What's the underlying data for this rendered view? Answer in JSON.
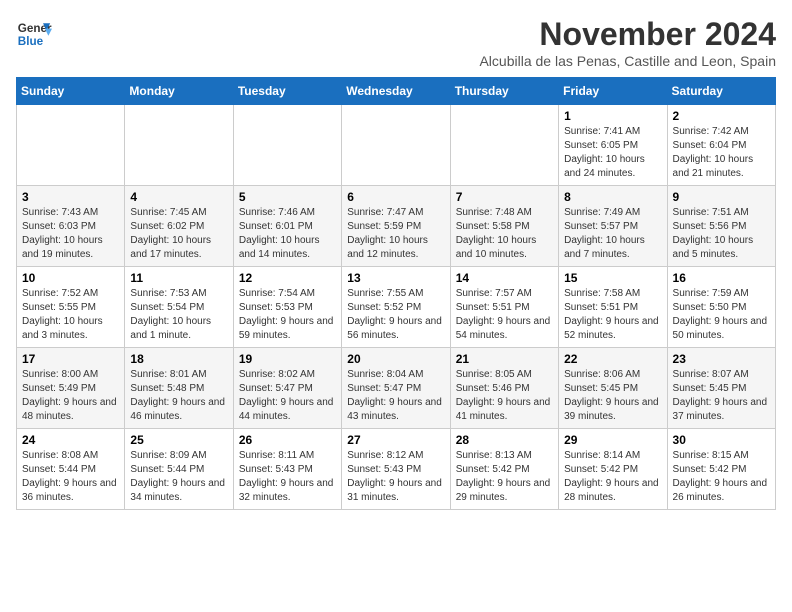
{
  "logo": {
    "line1": "General",
    "line2": "Blue"
  },
  "title": "November 2024",
  "subtitle": "Alcubilla de las Penas, Castille and Leon, Spain",
  "weekdays": [
    "Sunday",
    "Monday",
    "Tuesday",
    "Wednesday",
    "Thursday",
    "Friday",
    "Saturday"
  ],
  "weeks": [
    [
      {
        "day": "",
        "info": ""
      },
      {
        "day": "",
        "info": ""
      },
      {
        "day": "",
        "info": ""
      },
      {
        "day": "",
        "info": ""
      },
      {
        "day": "",
        "info": ""
      },
      {
        "day": "1",
        "info": "Sunrise: 7:41 AM\nSunset: 6:05 PM\nDaylight: 10 hours and 24 minutes."
      },
      {
        "day": "2",
        "info": "Sunrise: 7:42 AM\nSunset: 6:04 PM\nDaylight: 10 hours and 21 minutes."
      }
    ],
    [
      {
        "day": "3",
        "info": "Sunrise: 7:43 AM\nSunset: 6:03 PM\nDaylight: 10 hours and 19 minutes."
      },
      {
        "day": "4",
        "info": "Sunrise: 7:45 AM\nSunset: 6:02 PM\nDaylight: 10 hours and 17 minutes."
      },
      {
        "day": "5",
        "info": "Sunrise: 7:46 AM\nSunset: 6:01 PM\nDaylight: 10 hours and 14 minutes."
      },
      {
        "day": "6",
        "info": "Sunrise: 7:47 AM\nSunset: 5:59 PM\nDaylight: 10 hours and 12 minutes."
      },
      {
        "day": "7",
        "info": "Sunrise: 7:48 AM\nSunset: 5:58 PM\nDaylight: 10 hours and 10 minutes."
      },
      {
        "day": "8",
        "info": "Sunrise: 7:49 AM\nSunset: 5:57 PM\nDaylight: 10 hours and 7 minutes."
      },
      {
        "day": "9",
        "info": "Sunrise: 7:51 AM\nSunset: 5:56 PM\nDaylight: 10 hours and 5 minutes."
      }
    ],
    [
      {
        "day": "10",
        "info": "Sunrise: 7:52 AM\nSunset: 5:55 PM\nDaylight: 10 hours and 3 minutes."
      },
      {
        "day": "11",
        "info": "Sunrise: 7:53 AM\nSunset: 5:54 PM\nDaylight: 10 hours and 1 minute."
      },
      {
        "day": "12",
        "info": "Sunrise: 7:54 AM\nSunset: 5:53 PM\nDaylight: 9 hours and 59 minutes."
      },
      {
        "day": "13",
        "info": "Sunrise: 7:55 AM\nSunset: 5:52 PM\nDaylight: 9 hours and 56 minutes."
      },
      {
        "day": "14",
        "info": "Sunrise: 7:57 AM\nSunset: 5:51 PM\nDaylight: 9 hours and 54 minutes."
      },
      {
        "day": "15",
        "info": "Sunrise: 7:58 AM\nSunset: 5:51 PM\nDaylight: 9 hours and 52 minutes."
      },
      {
        "day": "16",
        "info": "Sunrise: 7:59 AM\nSunset: 5:50 PM\nDaylight: 9 hours and 50 minutes."
      }
    ],
    [
      {
        "day": "17",
        "info": "Sunrise: 8:00 AM\nSunset: 5:49 PM\nDaylight: 9 hours and 48 minutes."
      },
      {
        "day": "18",
        "info": "Sunrise: 8:01 AM\nSunset: 5:48 PM\nDaylight: 9 hours and 46 minutes."
      },
      {
        "day": "19",
        "info": "Sunrise: 8:02 AM\nSunset: 5:47 PM\nDaylight: 9 hours and 44 minutes."
      },
      {
        "day": "20",
        "info": "Sunrise: 8:04 AM\nSunset: 5:47 PM\nDaylight: 9 hours and 43 minutes."
      },
      {
        "day": "21",
        "info": "Sunrise: 8:05 AM\nSunset: 5:46 PM\nDaylight: 9 hours and 41 minutes."
      },
      {
        "day": "22",
        "info": "Sunrise: 8:06 AM\nSunset: 5:45 PM\nDaylight: 9 hours and 39 minutes."
      },
      {
        "day": "23",
        "info": "Sunrise: 8:07 AM\nSunset: 5:45 PM\nDaylight: 9 hours and 37 minutes."
      }
    ],
    [
      {
        "day": "24",
        "info": "Sunrise: 8:08 AM\nSunset: 5:44 PM\nDaylight: 9 hours and 36 minutes."
      },
      {
        "day": "25",
        "info": "Sunrise: 8:09 AM\nSunset: 5:44 PM\nDaylight: 9 hours and 34 minutes."
      },
      {
        "day": "26",
        "info": "Sunrise: 8:11 AM\nSunset: 5:43 PM\nDaylight: 9 hours and 32 minutes."
      },
      {
        "day": "27",
        "info": "Sunrise: 8:12 AM\nSunset: 5:43 PM\nDaylight: 9 hours and 31 minutes."
      },
      {
        "day": "28",
        "info": "Sunrise: 8:13 AM\nSunset: 5:42 PM\nDaylight: 9 hours and 29 minutes."
      },
      {
        "day": "29",
        "info": "Sunrise: 8:14 AM\nSunset: 5:42 PM\nDaylight: 9 hours and 28 minutes."
      },
      {
        "day": "30",
        "info": "Sunrise: 8:15 AM\nSunset: 5:42 PM\nDaylight: 9 hours and 26 minutes."
      }
    ]
  ]
}
